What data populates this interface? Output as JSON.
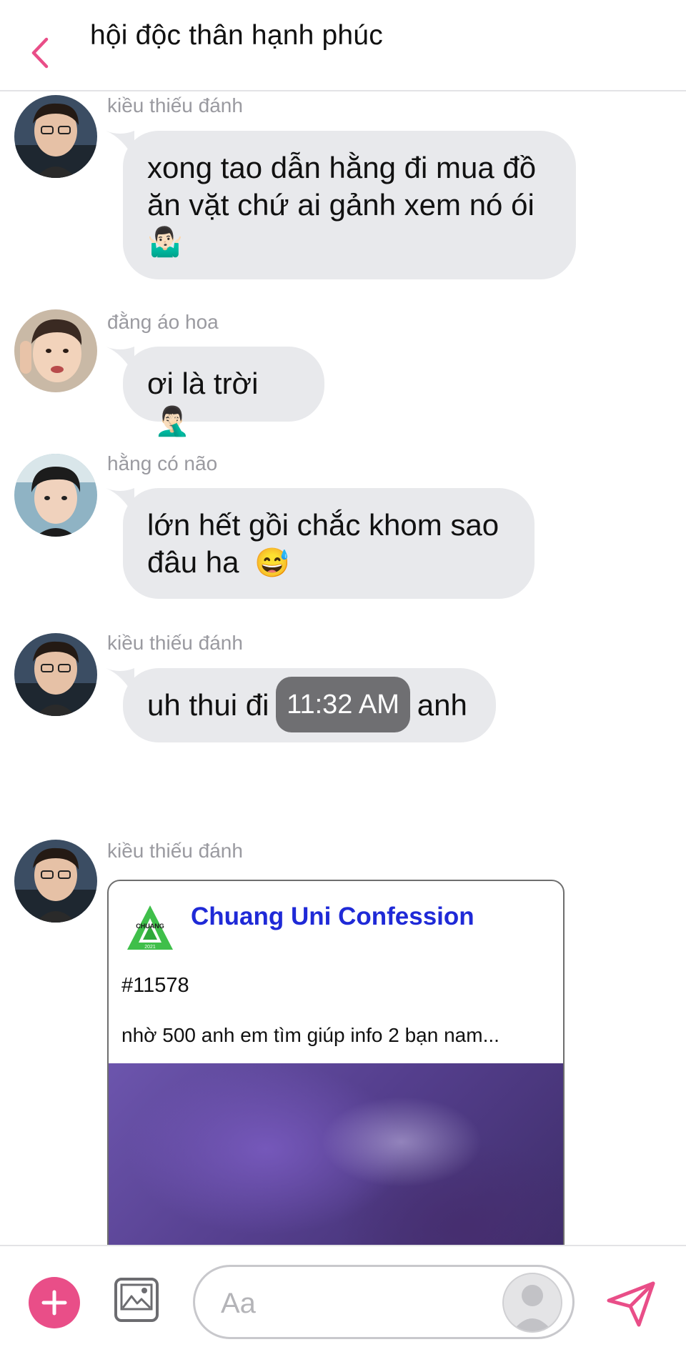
{
  "header": {
    "title": "hội độc thân hạnh phúc",
    "back_icon": "chevron-left-icon"
  },
  "colors": {
    "accent": "#e94e88",
    "bubble": "#e8e9ec",
    "sender": "#9a9aa0",
    "link_title": "#1f2ad7",
    "timestamp_bg": "#6f6f72"
  },
  "messages": [
    {
      "sender": "kiều thiếu đánh",
      "lines": [
        "xong tao dẫn hằng đi mua đồ",
        "ăn vặt chứ ai gảnh xem nó ói"
      ],
      "emoji": "🤷🏻‍♂️"
    },
    {
      "sender": "đằng áo hoa",
      "lines": [
        "ơi là trời"
      ],
      "emoji": "🤦🏻‍♂️"
    },
    {
      "sender": "hằng có não",
      "lines": [
        "lớn hết gồi chắc khom sao",
        "đâu ha"
      ],
      "emoji": "😅"
    },
    {
      "sender": "kiều thiếu đánh",
      "lines": [
        "uh thui đi chơi típ đi anh"
      ],
      "emoji": ""
    }
  ],
  "timestamp": "11:32 AM",
  "shared_post": {
    "sender": "kiều thiếu đánh",
    "page_name": "Chuang Uni Confession",
    "logo_text": "CHUANG",
    "logo_year": "2021",
    "post_id": "#11578",
    "excerpt": "nhờ 500 anh em tìm giúp info 2 bạn nam..."
  },
  "composer": {
    "placeholder": "Aa",
    "icons": [
      "plus-icon",
      "image-icon",
      "user-avatar-icon",
      "send-icon"
    ]
  }
}
